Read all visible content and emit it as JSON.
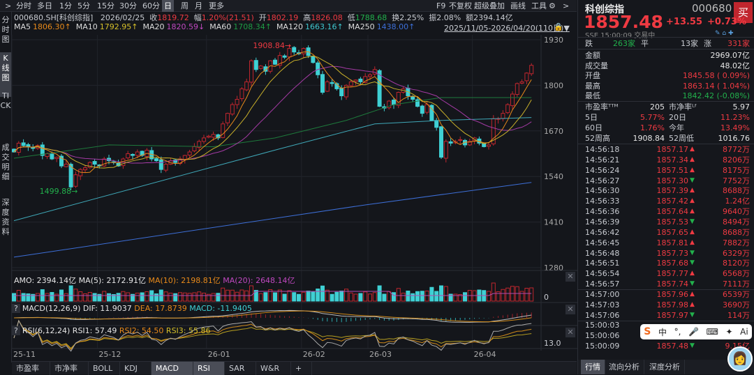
{
  "toolbar": {
    "expand": ">",
    "tabs": [
      "分时",
      "多日",
      "1分",
      "5分",
      "15分",
      "30分",
      "60分",
      "日",
      "周",
      "月",
      "更多"
    ],
    "selected": "日",
    "right": [
      "F9",
      "不复权",
      "超级叠加",
      "画线",
      "工具"
    ],
    "more": ">"
  },
  "sidebar": [
    "分时图",
    "K线图",
    "TICK",
    "成交明细",
    "深度资料"
  ],
  "info": {
    "code": "000680.SH[科创综指]",
    "date": "2026/02/25",
    "close_label": "收",
    "close": "1819.72",
    "chg_label": "幅",
    "chg": "1.20%(21.51)",
    "open_label": "开",
    "open": "1802.19",
    "high_label": "高",
    "high": "1826.08",
    "low_label": "低",
    "low": "1788.68",
    "turn_label": "换",
    "turn": "2.25%",
    "amp_label": "振",
    "amp": "2.08%",
    "amt_label": "额",
    "amt": "2394.14亿"
  },
  "ma": [
    {
      "label": "MA5",
      "value": "1806.30↑",
      "color": "#e88a1a"
    },
    {
      "label": "MA10",
      "value": "1792.95↑",
      "color": "#d6c02a"
    },
    {
      "label": "MA20",
      "value": "1820.59↓",
      "color": "#c048c0"
    },
    {
      "label": "MA60",
      "value": "1708.34↑",
      "color": "#1e9b44"
    },
    {
      "label": "MA120",
      "value": "1663.16↑",
      "color": "#3fc8d0"
    },
    {
      "label": "MA250",
      "value": "1438.00↑",
      "color": "#3d6fd8"
    }
  ],
  "range": "2025/11/05-2026/04/20(110日)▼",
  "colors": {
    "up": "#c0262e",
    "down": "#3fd0d4",
    "accent": "#ef3a42",
    "fall": "#22b14c"
  },
  "chart_data": {
    "type": "candlestick",
    "price_axis": [
      "1930",
      "1800",
      "1670",
      "1540",
      "1410",
      "1280"
    ],
    "ylim": [
      1280,
      1930
    ],
    "x_labels": [
      "25-11",
      "25-12",
      "26-01",
      "26-02",
      "26-03",
      "26-04"
    ],
    "x_label_index": [
      0,
      18,
      41,
      61,
      75,
      97
    ],
    "high_marker": "1908.84",
    "low_marker": "1499.88",
    "close": [
      1610,
      1635,
      1628,
      1625,
      1620,
      1628,
      1600,
      1605,
      1590,
      1595,
      1570,
      1575,
      1510,
      1545,
      1560,
      1565,
      1580,
      1575,
      1570,
      1590,
      1585,
      1580,
      1570,
      1590,
      1605,
      1600,
      1610,
      1600,
      1615,
      1590,
      1585,
      1560,
      1575,
      1585,
      1580,
      1590,
      1600,
      1610,
      1625,
      1640,
      1650,
      1655,
      1660,
      1650,
      1690,
      1720,
      1745,
      1760,
      1790,
      1810,
      1870,
      1845,
      1855,
      1840,
      1870,
      1860,
      1885,
      1880,
      1905,
      1895,
      1890,
      1905,
      1885,
      1865,
      1830,
      1780,
      1810,
      1805,
      1790,
      1770,
      1800,
      1810,
      1815,
      1810,
      1825,
      1830,
      1845,
      1740,
      1735,
      1755,
      1745,
      1780,
      1790,
      1770,
      1760,
      1740,
      1720,
      1745,
      1700,
      1680,
      1595,
      1640,
      1635,
      1640,
      1645,
      1630,
      1640,
      1650,
      1635,
      1625,
      1630,
      1705,
      1705,
      1720,
      1745,
      1775,
      1805,
      1810,
      1835,
      1857
    ],
    "ma60_anchors": [
      [
        0,
        1592
      ],
      [
        20,
        1630
      ],
      [
        42,
        1625
      ],
      [
        55,
        1650
      ],
      [
        70,
        1700
      ],
      [
        80,
        1745
      ],
      [
        90,
        1765
      ],
      [
        109,
        1765
      ]
    ],
    "ma120_anchors": [
      [
        0,
        1414
      ],
      [
        56,
        1619
      ],
      [
        76,
        1690
      ],
      [
        90,
        1700
      ],
      [
        109,
        1708
      ]
    ],
    "ma250_anchors": [
      [
        0,
        1310
      ],
      [
        74,
        1459
      ],
      [
        109,
        1523
      ]
    ]
  },
  "amo": {
    "label": "AMO: 2394.14亿",
    "ma5": "MA(5): 2172.91亿",
    "ma10": "MA(10): 2198.81亿",
    "ma20": "MA(20): 2648.14亿",
    "axis": "0"
  },
  "macd": {
    "help": "?",
    "label": "MACD(12,26,9)",
    "dif": "DIF: 11.9037",
    "dea": "DEA: 17.8739",
    "macd": "MACD: -11.9405"
  },
  "rsi": {
    "help": "?",
    "label": "RSI(6,12,24)",
    "rsi1": "RSI1: 57.49",
    "rsi2": "RSI2: 54.50",
    "rsi3": "RSI3: 55.86",
    "axis": "13.0"
  },
  "close_x": "✕",
  "bottom_tabs": [
    "市盈率",
    "市净率",
    "BOLL",
    "KDJ",
    "MACD",
    "RSI",
    "SAR",
    "W&R",
    "+"
  ],
  "quote": {
    "name": "科创综指",
    "code": "000680",
    "buy": "买",
    "price": "1857.48",
    "change": "+13.55",
    "pct": "+0.73%",
    "status": "SSE  15:00:09  交易中",
    "breadth": {
      "down_label": "跌",
      "down": "263家",
      "flat_label": "平",
      "flat": "13家",
      "up_label": "涨",
      "up": "331家"
    },
    "stats": [
      {
        "label": "金额",
        "value": "2969.07亿",
        "c": "white"
      },
      {
        "label": "成交量",
        "value": "48.02亿",
        "c": "white"
      },
      {
        "label": "开盘",
        "value": "1845.58 ( 0.09%)",
        "c": "red"
      },
      {
        "label": "最高",
        "value": "1863.14 ( 1.04%)",
        "c": "red"
      },
      {
        "label": "最低",
        "value": "1842.42 (-0.08%)",
        "c": "green"
      }
    ],
    "grid": [
      {
        "l1": "市盈率ᵀᵀᴹ",
        "v1": "205",
        "c1": "white",
        "l2": "市净率ᴸᶠ",
        "v2": "5.97",
        "c2": "white"
      },
      {
        "l1": "5日",
        "v1": "5.77%",
        "c1": "red",
        "l2": "20日",
        "v2": "11.23%",
        "c2": "red"
      },
      {
        "l1": "60日",
        "v1": "1.76%",
        "c1": "red",
        "l2": "今年",
        "v2": "13.49%",
        "c2": "red"
      },
      {
        "l1": "52周高",
        "v1": "1908.84",
        "c1": "white",
        "l2": "52周低",
        "v2": "1016.76",
        "c2": "white"
      }
    ]
  },
  "ticks": [
    {
      "t": "14:56:18",
      "p": "1857.17",
      "d": "up",
      "v": "8772万"
    },
    {
      "t": "14:56:21",
      "p": "1857.34",
      "d": "up",
      "v": "8206万"
    },
    {
      "t": "14:56:24",
      "p": "1857.51",
      "d": "up",
      "v": "8175万"
    },
    {
      "t": "14:56:27",
      "p": "1857.30",
      "d": "down",
      "v": "7752万"
    },
    {
      "t": "14:56:30",
      "p": "1857.39",
      "d": "up",
      "v": "8688万"
    },
    {
      "t": "14:56:33",
      "p": "1857.42",
      "d": "up",
      "v": "1.24亿"
    },
    {
      "t": "14:56:36",
      "p": "1857.64",
      "d": "up",
      "v": "9640万"
    },
    {
      "t": "14:56:39",
      "p": "1857.53",
      "d": "down",
      "v": "8494万"
    },
    {
      "t": "14:56:42",
      "p": "1857.65",
      "d": "up",
      "v": "8688万"
    },
    {
      "t": "14:56:45",
      "p": "1857.81",
      "d": "up",
      "v": "7882万"
    },
    {
      "t": "14:56:48",
      "p": "1857.73",
      "d": "down",
      "v": "6329万"
    },
    {
      "t": "14:56:51",
      "p": "1857.68",
      "d": "down",
      "v": "8120万"
    },
    {
      "t": "14:56:54",
      "p": "1857.77",
      "d": "up",
      "v": "6568万"
    },
    {
      "t": "14:56:57",
      "p": "1857.74",
      "d": "down",
      "v": "7111万"
    },
    {
      "t": "14:57:00",
      "p": "1857.96",
      "d": "up",
      "v": "6539万"
    },
    {
      "t": "14:57:03",
      "p": "1857.98",
      "d": "up",
      "v": "3690万"
    },
    {
      "t": "14:57:06",
      "p": "1857.97",
      "d": "down",
      "v": "114万"
    },
    {
      "t": "15:00:03",
      "p": "",
      "d": "",
      "v": ""
    },
    {
      "t": "15:00:06",
      "p": "",
      "d": "",
      "v": ""
    },
    {
      "t": "15:00:09",
      "p": "1857.48",
      "d": "down",
      "v": "9.15亿"
    }
  ],
  "right_tabs": [
    "行情",
    "流向分析",
    "深度分析"
  ],
  "ime": {
    "logo": "S",
    "items": [
      "中",
      "°,",
      "🎤",
      "⌨",
      "✦",
      "Ai"
    ]
  }
}
